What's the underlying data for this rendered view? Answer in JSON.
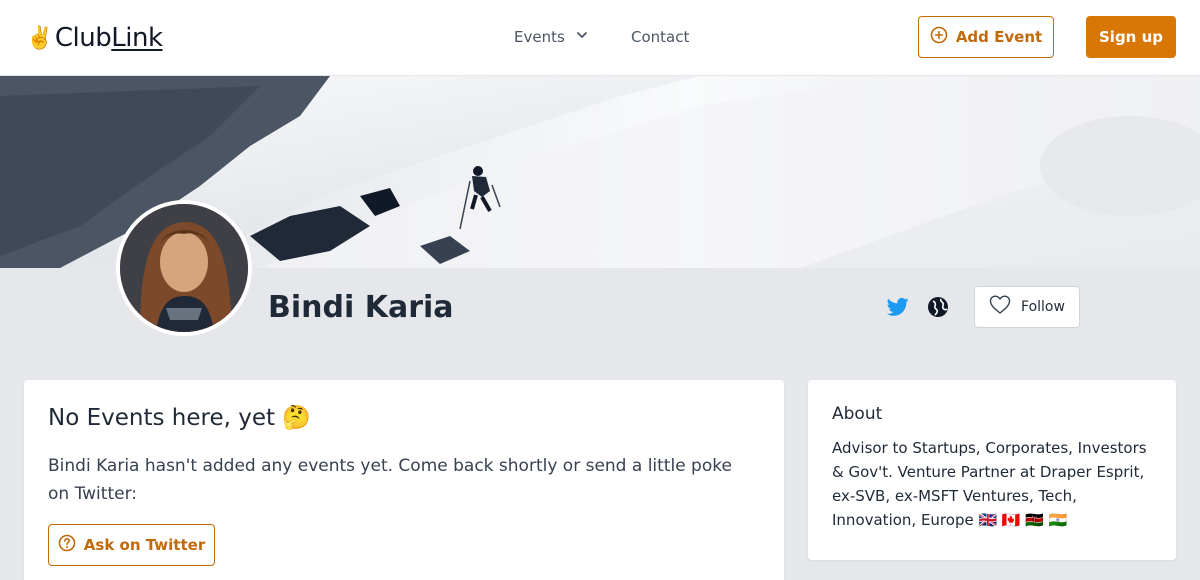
{
  "header": {
    "logo_emoji": "✌️",
    "logo_club": "Club",
    "logo_link": "Link",
    "nav_events": "Events",
    "nav_contact": "Contact",
    "add_event_label": "Add Event",
    "sign_up_label": "Sign up",
    "accent_color": "#d97706"
  },
  "profile": {
    "name": "Bindi Karia",
    "follow_label": "Follow",
    "twitter_color": "#1d9bf0"
  },
  "events": {
    "title": "No Events here, yet 🤔",
    "message": "Bindi Karia hasn't added any events yet. Come back shortly or send a little poke on Twitter:",
    "ask_button_label": "Ask on Twitter"
  },
  "about": {
    "title": "About",
    "text": "Advisor to Startups, Corporates, Investors & Gov't. Venture Partner at Draper Esprit, ex-SVB, ex-MSFT Ventures, Tech, Innovation, Europe 🇬🇧 🇨🇦 🇰🇪 🇮🇳"
  },
  "icons": {
    "chevron": "chevron-down-icon",
    "add": "plus-circle-icon",
    "twitter": "twitter-icon",
    "globe": "globe-icon",
    "heart": "heart-icon",
    "help": "question-circle-icon"
  }
}
